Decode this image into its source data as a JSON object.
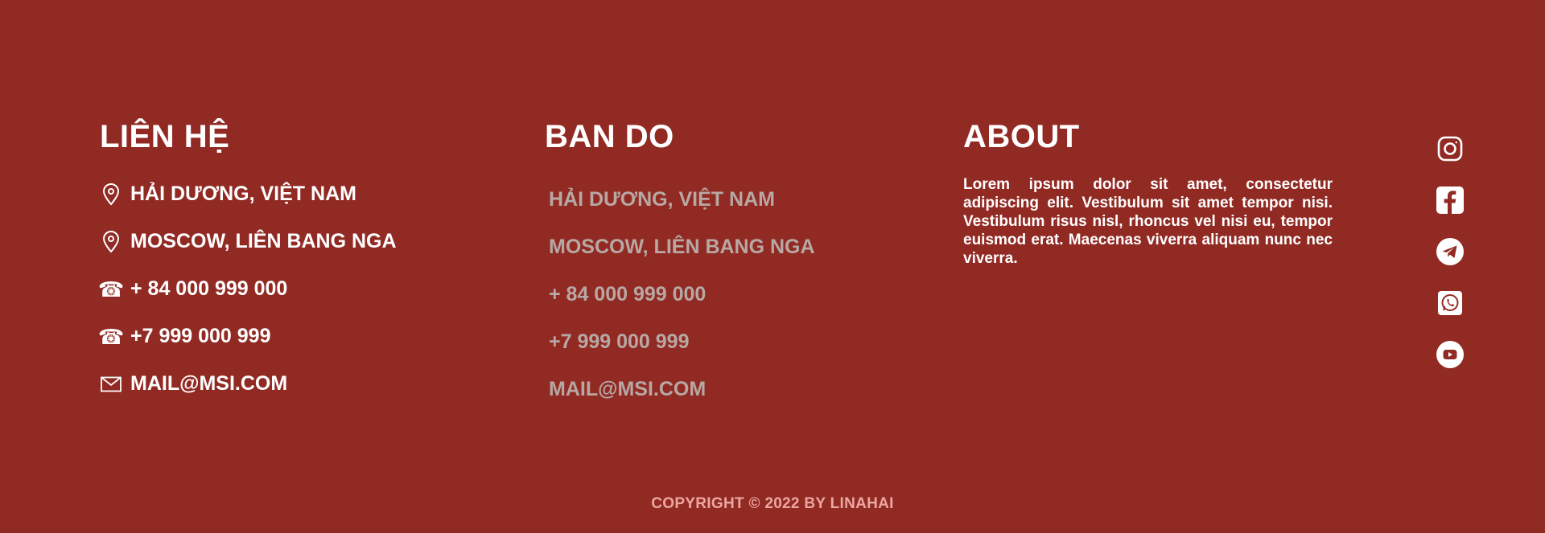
{
  "contact": {
    "title": "LIÊN HỆ",
    "items": [
      {
        "icon": "map-pin-icon",
        "text": "HẢI DƯƠNG, VIỆT NAM"
      },
      {
        "icon": "map-pin-icon",
        "text": "MOSCOW, LIÊN BANG NGA"
      },
      {
        "icon": "phone-icon",
        "text": "+ 84 000 999 000"
      },
      {
        "icon": "phone-icon",
        "text": "+7 999 000 999"
      },
      {
        "icon": "mail-icon",
        "text": "MAIL@MSI.COM"
      }
    ]
  },
  "map": {
    "title": "BAN DO",
    "items": [
      "HẢI DƯƠNG, VIỆT NAM",
      "MOSCOW, LIÊN BANG NGA",
      "+ 84 000 999 000",
      "+7 999 000 999",
      "MAIL@MSI.COM"
    ]
  },
  "about": {
    "title": "ABOUT",
    "text": "Lorem ipsum dolor sit amet, consectetur adipiscing elit. Vestibulum sit amet tempor nisi. Vestibulum risus nisl, rhoncus vel nisi eu, tempor euismod erat. Maecenas viverra aliquam nunc nec viverra."
  },
  "social": [
    {
      "icon": "instagram-icon"
    },
    {
      "icon": "facebook-icon"
    },
    {
      "icon": "telegram-icon"
    },
    {
      "icon": "whatsapp-icon"
    },
    {
      "icon": "youtube-icon"
    }
  ],
  "footer": {
    "copyright": "COPYRIGHT © 2022 BY LINAHAI"
  },
  "colors": {
    "background": "#922a24",
    "text": "#ffffff",
    "muted_text": "#b7a8a4",
    "copyright": "#eca6a0"
  }
}
